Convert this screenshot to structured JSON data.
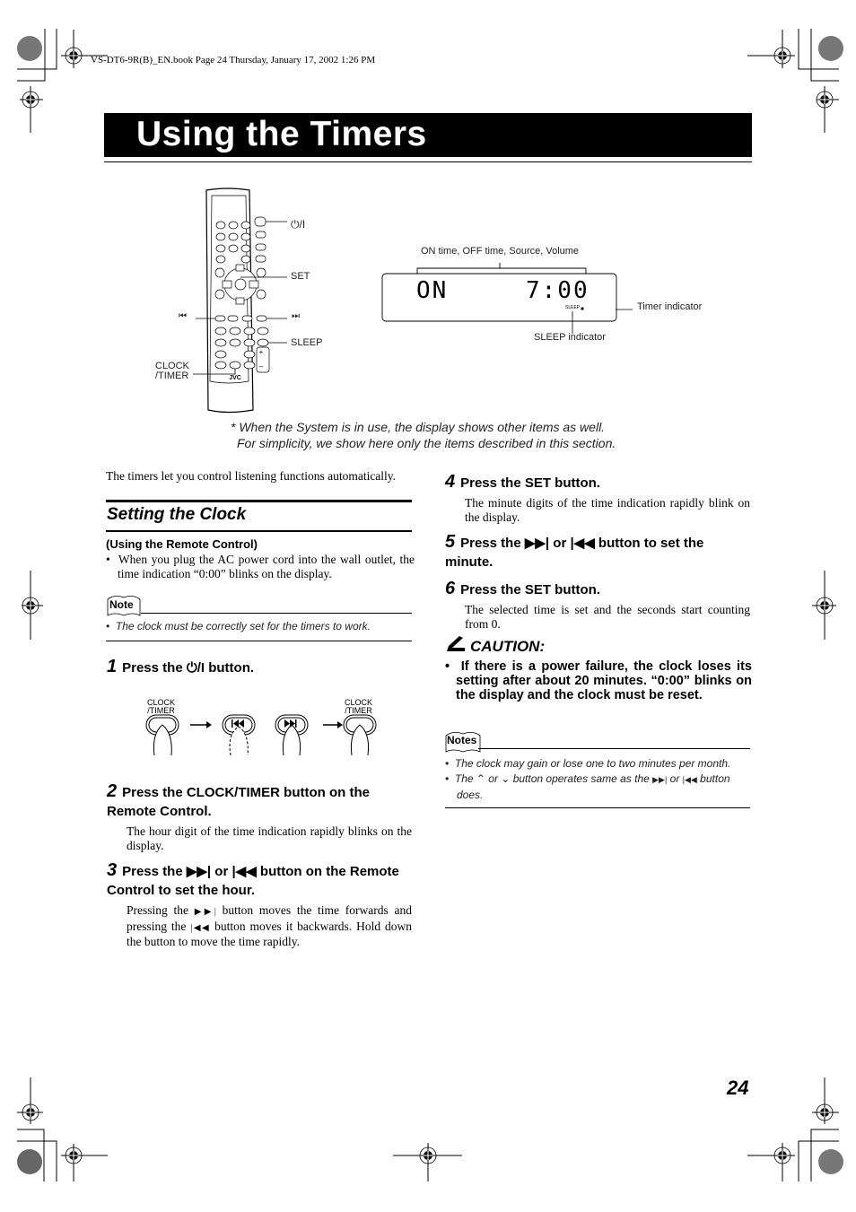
{
  "print_header": "VS-DT6-9R(B)_EN.book  Page 24  Thursday, January 17, 2002  1:26 PM",
  "page_title": "Using the Timers",
  "page_number": "24",
  "figure": {
    "remote_labels": {
      "power": "⏻/I",
      "set": "SET",
      "prev": "⏮",
      "next": "⏭",
      "sleep": "SLEEP",
      "clock_timer_line1": "CLOCK",
      "clock_timer_line2": "/TIMER",
      "brand": "JVC"
    },
    "display": {
      "bracket_label": "ON time, OFF time, Source, Volume",
      "left_text": "ON",
      "right_text": "7:00",
      "sleep_mark": "SLEEP",
      "timer_indicator_label": "Timer indicator",
      "sleep_indicator_label": "SLEEP indicator"
    },
    "footnote_line1": "* When the System is in use, the display shows other items as well.",
    "footnote_line2": "For simplicity, we show here only the items described in this section."
  },
  "left": {
    "intro": "The timers let you control listening functions automatically.",
    "section_title": "Setting the Clock",
    "subheading": "(Using the Remote Control)",
    "bullet": "When you plug the AC power cord into the wall outlet, the time indication “0:00” blinks on the display.",
    "note_label": "Note",
    "note_text": "The clock must be correctly set for the timers to work.",
    "steps": [
      {
        "num": "1",
        "pre": "Press the ",
        "post": " button.",
        "body": ""
      },
      {
        "num": "2",
        "title": "Press the CLOCK/TIMER button on the Remote Control.",
        "body": "The hour digit of the time indication rapidly blinks on the display."
      },
      {
        "num": "3",
        "title_a": "Press the ",
        "title_b": " or ",
        "title_c": " button on the Remote Control to set the hour.",
        "body_a": "Pressing the ",
        "body_b": " button moves the time forwards and pressing the ",
        "body_c": " button moves it backwards. Hold down the button to move the time rapidly."
      }
    ],
    "sequence_labels": {
      "clock_line1": "CLOCK",
      "clock_line2": "/TIMER"
    }
  },
  "right": {
    "steps": [
      {
        "num": "4",
        "title": "Press the SET button.",
        "body": "The minute digits of the time indication rapidly blink on the display."
      },
      {
        "num": "5",
        "title_a": "Press the ",
        "title_b": " or ",
        "title_c": " button to set the minute."
      },
      {
        "num": "6",
        "title": "Press the SET button.",
        "body": "The selected time is set and the seconds start counting from 0."
      }
    ],
    "caution_label": "CAUTION:",
    "caution_text": "If there is a power failure, the clock loses its setting after about 20 minutes. “0:00” blinks on the display and the clock must be reset.",
    "notes_label": "Notes",
    "notes": [
      "The clock may gain or lose one to two minutes per month.",
      {
        "a": "The ",
        "b": " or ",
        "c": " button operates same as the ",
        "d": " or ",
        "e": " button does."
      }
    ]
  }
}
